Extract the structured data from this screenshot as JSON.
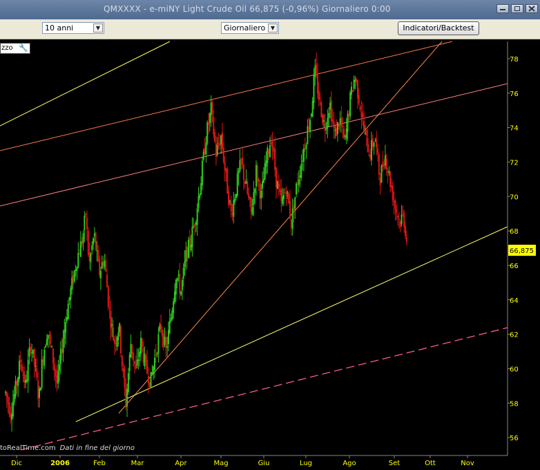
{
  "window": {
    "title": "QMXXXX - e-miNY Light Crude Oil    66,875 (-0,96%)    Giornaliero  0:00"
  },
  "toolbar": {
    "range_select": "10 anni",
    "period_select": "Giornaliero",
    "indicators_button": "Indicatori/Backtest"
  },
  "chip": {
    "label": "zzo",
    "icon": "wrench-icon"
  },
  "footnote": {
    "source": "toRealTime.com",
    "note": "Dati in fine del giorno"
  },
  "chart_data": {
    "type": "candlestick",
    "ylim": [
      55,
      79
    ],
    "y_ticks": [
      56,
      58,
      60,
      62,
      64,
      66,
      68,
      70,
      72,
      74,
      76,
      78
    ],
    "x_ticks": [
      "Dic",
      "2006",
      "Feb",
      "Mar",
      "Apr",
      "Mag",
      "Giu",
      "Lug",
      "Ago",
      "Set",
      "Ott",
      "Nov"
    ],
    "last_price": "66,875",
    "colors": {
      "up": "#2ecc1a",
      "down": "#e01515",
      "axis_text": "#ffff00",
      "last_badge": "#ffff00"
    },
    "price_path": [
      [
        0,
        58.6
      ],
      [
        0.3,
        57.5
      ],
      [
        0.6,
        58.8
      ],
      [
        0.9,
        60.5
      ],
      [
        1.2,
        59.0
      ],
      [
        1.5,
        61.5
      ],
      [
        1.8,
        59.8
      ],
      [
        2.0,
        58.2
      ],
      [
        2.2,
        60.5
      ],
      [
        2.5,
        62.3
      ],
      [
        2.8,
        60.8
      ],
      [
        3.1,
        59.0
      ],
      [
        3.4,
        61.5
      ],
      [
        3.7,
        63.5
      ],
      [
        4.0,
        65.0
      ],
      [
        4.3,
        66.5
      ],
      [
        4.6,
        67.5
      ],
      [
        4.8,
        69.0
      ],
      [
        5.0,
        66.0
      ],
      [
        5.3,
        67.8
      ],
      [
        5.6,
        65.5
      ],
      [
        5.9,
        66.5
      ],
      [
        6.2,
        63.5
      ],
      [
        6.5,
        61.5
      ],
      [
        6.8,
        62.5
      ],
      [
        7.0,
        60.0
      ],
      [
        7.2,
        58.0
      ],
      [
        7.5,
        61.5
      ],
      [
        7.8,
        59.8
      ],
      [
        8.1,
        61.5
      ],
      [
        8.4,
        60.0
      ],
      [
        8.7,
        59.3
      ],
      [
        9.0,
        61.0
      ],
      [
        9.3,
        62.5
      ],
      [
        9.6,
        61.0
      ],
      [
        9.9,
        63.0
      ],
      [
        10.2,
        65.5
      ],
      [
        10.5,
        64.5
      ],
      [
        10.8,
        66.5
      ],
      [
        11.1,
        67.5
      ],
      [
        11.4,
        69.0
      ],
      [
        11.7,
        71.0
      ],
      [
        12.0,
        73.5
      ],
      [
        12.3,
        75.0
      ],
      [
        12.6,
        72.5
      ],
      [
        12.9,
        73.5
      ],
      [
        13.2,
        71.0
      ],
      [
        13.5,
        69.0
      ],
      [
        13.8,
        70.5
      ],
      [
        14.1,
        72.0
      ],
      [
        14.4,
        70.5
      ],
      [
        14.7,
        69.0
      ],
      [
        15.0,
        71.5
      ],
      [
        15.3,
        70.0
      ],
      [
        15.6,
        72.0
      ],
      [
        15.9,
        73.5
      ],
      [
        16.2,
        71.0
      ],
      [
        16.5,
        69.5
      ],
      [
        16.8,
        70.5
      ],
      [
        17.1,
        68.5
      ],
      [
        17.4,
        70.5
      ],
      [
        17.7,
        72.0
      ],
      [
        18.0,
        73.5
      ],
      [
        18.3,
        75.0
      ],
      [
        18.5,
        77.3
      ],
      [
        18.8,
        75.5
      ],
      [
        19.1,
        74.0
      ],
      [
        19.4,
        75.5
      ],
      [
        19.7,
        73.5
      ],
      [
        20.0,
        74.5
      ],
      [
        20.3,
        73.0
      ],
      [
        20.6,
        75.5
      ],
      [
        20.9,
        77.0
      ],
      [
        21.2,
        75.5
      ],
      [
        21.5,
        73.5
      ],
      [
        21.8,
        72.5
      ],
      [
        22.1,
        73.5
      ],
      [
        22.4,
        71.0
      ],
      [
        22.7,
        72.5
      ],
      [
        23.0,
        71.0
      ],
      [
        23.3,
        69.5
      ],
      [
        23.6,
        68.5
      ],
      [
        23.8,
        69.0
      ],
      [
        24.0,
        67.5
      ]
    ]
  }
}
